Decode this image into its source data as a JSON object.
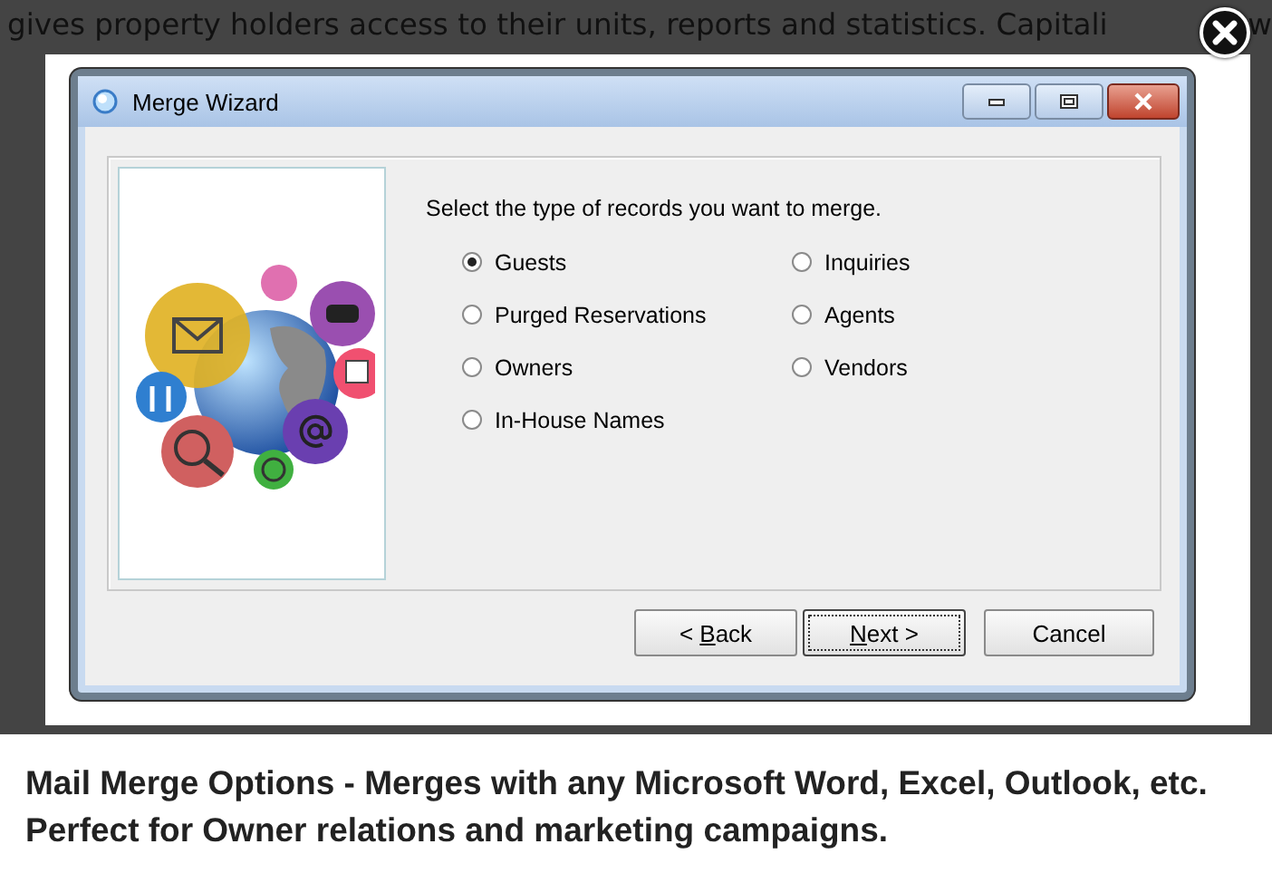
{
  "background_text": [
    "gives property holders access to their units, reports and statistics. Capitali",
    "w"
  ],
  "dialog": {
    "title": "Merge Wizard",
    "instruction": "Select the type of records you want to merge.",
    "option_columns": [
      [
        {
          "label": "Guests",
          "selected": true
        },
        {
          "label": "Purged Reservations",
          "selected": false
        },
        {
          "label": "Owners",
          "selected": false
        },
        {
          "label": "In-House Names",
          "selected": false
        }
      ],
      [
        {
          "label": "Inquiries",
          "selected": false
        },
        {
          "label": "Agents",
          "selected": false
        },
        {
          "label": "Vendors",
          "selected": false
        }
      ]
    ],
    "buttons": [
      {
        "before": "< ",
        "access_key": "B",
        "after": "ack",
        "focused": false
      },
      {
        "access_key": "N",
        "after": "ext >",
        "focused": true
      },
      {
        "before": "Cancel",
        "focused": false
      }
    ]
  },
  "caption": "Mail Merge Options - Merges with any Microsoft Word, Excel, Outlook, etc. Perfect for Owner relations and marketing campaigns."
}
